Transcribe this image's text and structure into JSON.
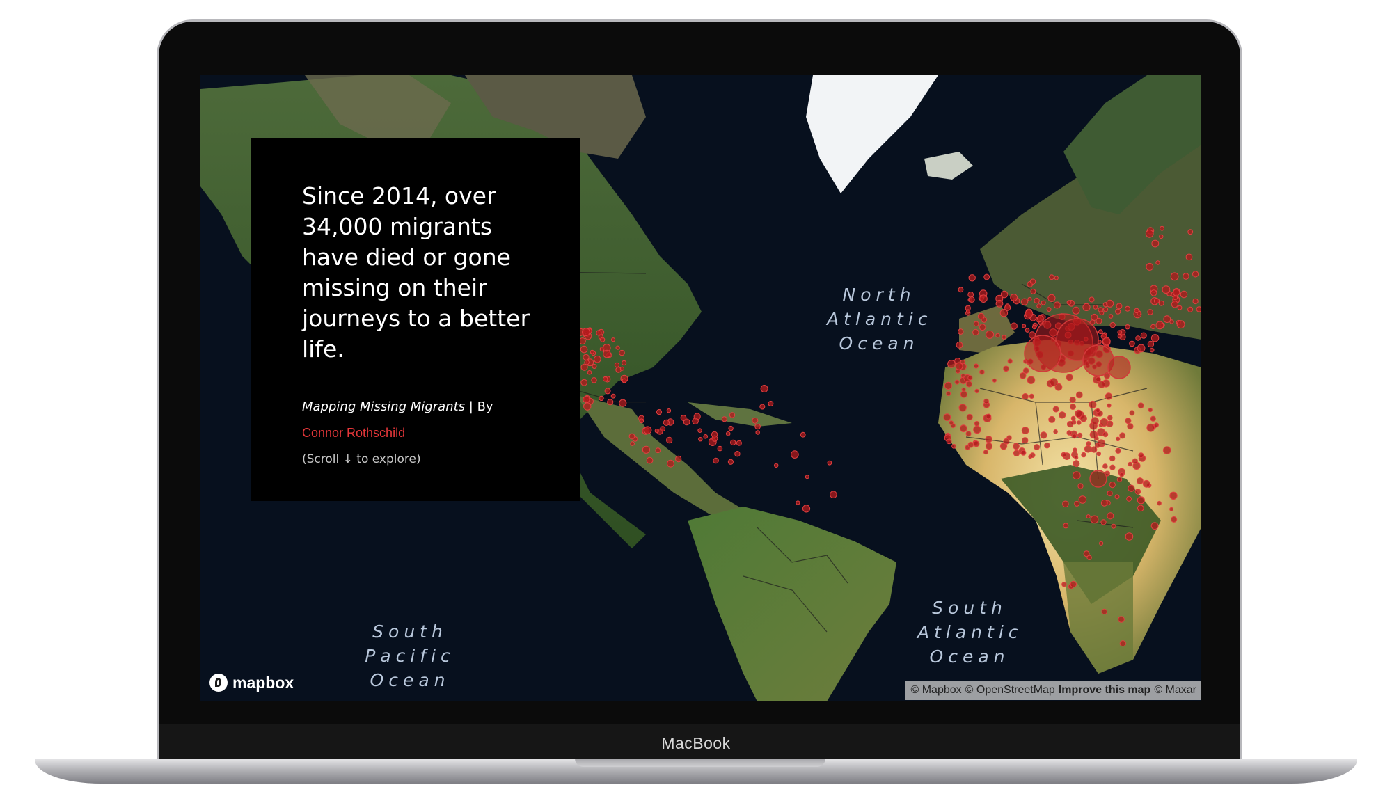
{
  "device": {
    "brand": "MacBook"
  },
  "map": {
    "ocean_labels": [
      {
        "lines": [
          "North",
          "Atlantic",
          "Ocean"
        ]
      },
      {
        "lines": [
          "South",
          "Atlantic",
          "Ocean"
        ]
      },
      {
        "lines": [
          "South",
          "Pacific",
          "Ocean"
        ]
      }
    ],
    "marker_color": "#b3191c",
    "logo_text": "mapbox",
    "attribution": {
      "mapbox": "© Mapbox",
      "osm": "© OpenStreetMap",
      "improve": "Improve this map",
      "maxar": "© Maxar"
    }
  },
  "intro": {
    "headline": "Since 2014, over 34,000 migrants have died or gone missing on their journeys to a better life.",
    "project_title": "Mapping Missing Migrants",
    "by_text": "| By",
    "author": "Connor Rothschild",
    "scroll_hint": "(Scroll ↓ to explore)",
    "accent_color": "#e5373a"
  }
}
